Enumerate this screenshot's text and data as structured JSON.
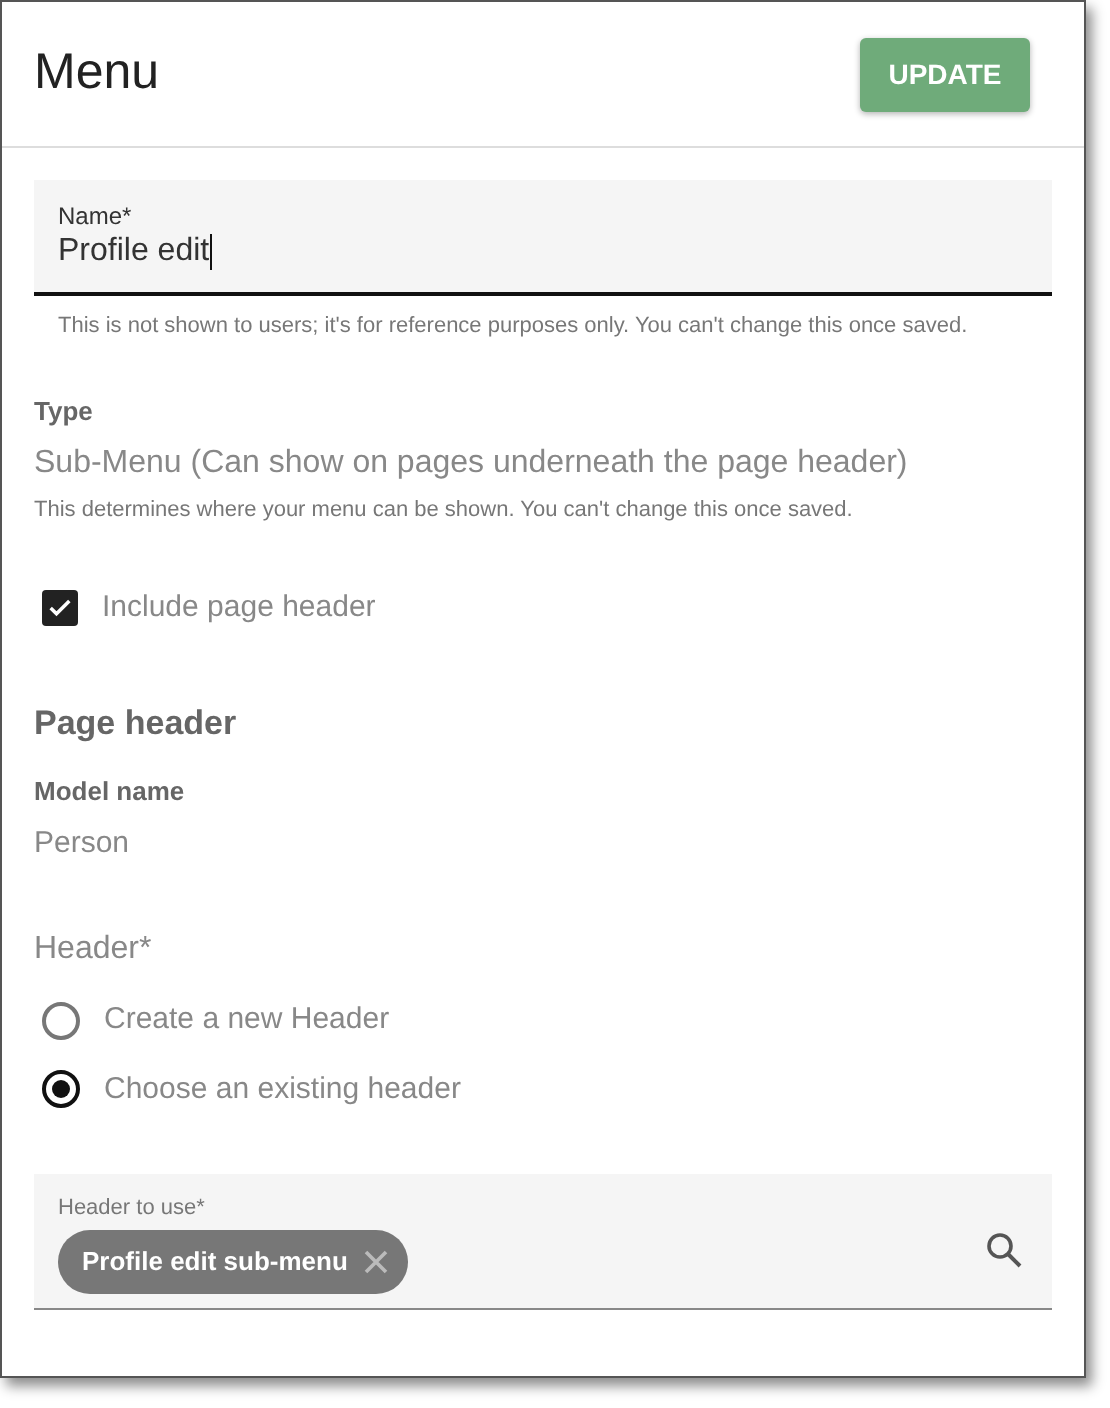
{
  "title": "Menu",
  "update_button": "UPDATE",
  "name_field": {
    "label": "Name*",
    "value": "Profile edit",
    "focused": true,
    "helper": "This is not shown to users; it's for reference purposes only. You can't change this once saved."
  },
  "type": {
    "label": "Type",
    "value": "Sub-Menu (Can show on pages underneath the page header)",
    "hint": "This determines where your menu can be shown. You can't change this once saved."
  },
  "include_header": {
    "label": "Include page header",
    "checked": true
  },
  "section_title": "Page header",
  "model": {
    "label": "Model name",
    "value": "Person"
  },
  "header_group": {
    "label": "Header*",
    "options": [
      {
        "label": "Create a new Header",
        "selected": false
      },
      {
        "label": "Choose an existing header",
        "selected": true
      }
    ]
  },
  "header_to_use": {
    "label": "Header to use*",
    "chips": [
      "Profile edit sub-menu"
    ]
  }
}
